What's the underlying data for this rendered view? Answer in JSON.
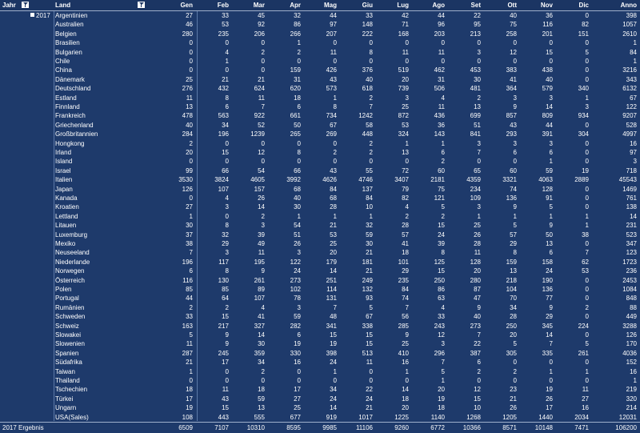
{
  "header": {
    "jahr": "Jahr",
    "land": "Land",
    "months": [
      "Gen",
      "Feb",
      "Mar",
      "Apr",
      "Mag",
      "Giu",
      "Lug",
      "Ago",
      "Set",
      "Ott",
      "Nov",
      "Dic"
    ],
    "anno": "Anno"
  },
  "year_label": "2017",
  "icons": {
    "filter": "filter-icon",
    "collapse": "collapse-icon"
  },
  "rows": [
    {
      "land": "Argentinien",
      "v": [
        "27",
        "33",
        "45",
        "32",
        "44",
        "33",
        "42",
        "44",
        "22",
        "40",
        "36",
        "0",
        "398"
      ]
    },
    {
      "land": "Australien",
      "v": [
        "46",
        "53",
        "92",
        "86",
        "97",
        "148",
        "71",
        "96",
        "95",
        "75",
        "116",
        "82",
        "1057"
      ]
    },
    {
      "land": "Belgien",
      "v": [
        "280",
        "235",
        "206",
        "266",
        "207",
        "222",
        "168",
        "203",
        "213",
        "258",
        "201",
        "151",
        "2610"
      ]
    },
    {
      "land": "Brasilien",
      "v": [
        "0",
        "0",
        "0",
        "1",
        "0",
        "0",
        "0",
        "0",
        "0",
        "0",
        "0",
        "0",
        "1"
      ]
    },
    {
      "land": "Bulgarien",
      "v": [
        "0",
        "4",
        "2",
        "2",
        "11",
        "8",
        "11",
        "11",
        "3",
        "12",
        "15",
        "5",
        "84"
      ]
    },
    {
      "land": "Chile",
      "v": [
        "0",
        "1",
        "0",
        "0",
        "0",
        "0",
        "0",
        "0",
        "0",
        "0",
        "0",
        "0",
        "1"
      ]
    },
    {
      "land": "China",
      "v": [
        "0",
        "0",
        "0",
        "159",
        "426",
        "376",
        "519",
        "462",
        "453",
        "383",
        "438",
        "0",
        "3216"
      ]
    },
    {
      "land": "Dänemark",
      "v": [
        "25",
        "21",
        "21",
        "31",
        "43",
        "40",
        "20",
        "31",
        "30",
        "41",
        "40",
        "0",
        "343"
      ]
    },
    {
      "land": "Deutschland",
      "v": [
        "276",
        "432",
        "624",
        "620",
        "573",
        "618",
        "739",
        "506",
        "481",
        "364",
        "579",
        "340",
        "6132"
      ]
    },
    {
      "land": "Estland",
      "v": [
        "11",
        "8",
        "11",
        "18",
        "1",
        "2",
        "3",
        "4",
        "2",
        "3",
        "3",
        "1",
        "67"
      ]
    },
    {
      "land": "Finnland",
      "v": [
        "13",
        "6",
        "7",
        "6",
        "8",
        "7",
        "25",
        "11",
        "13",
        "9",
        "14",
        "3",
        "122"
      ]
    },
    {
      "land": "Frankreich",
      "v": [
        "478",
        "563",
        "922",
        "661",
        "734",
        "1242",
        "872",
        "436",
        "699",
        "857",
        "809",
        "934",
        "9207"
      ]
    },
    {
      "land": "Griechenland",
      "v": [
        "40",
        "34",
        "52",
        "50",
        "67",
        "58",
        "53",
        "36",
        "51",
        "43",
        "44",
        "0",
        "528"
      ]
    },
    {
      "land": "Großbritannien",
      "v": [
        "284",
        "196",
        "1239",
        "265",
        "269",
        "448",
        "324",
        "143",
        "841",
        "293",
        "391",
        "304",
        "4997"
      ]
    },
    {
      "land": "Hongkong",
      "v": [
        "2",
        "0",
        "0",
        "0",
        "0",
        "2",
        "1",
        "1",
        "3",
        "3",
        "3",
        "0",
        "16"
      ]
    },
    {
      "land": "Irland",
      "v": [
        "20",
        "15",
        "12",
        "8",
        "2",
        "2",
        "13",
        "6",
        "7",
        "6",
        "6",
        "0",
        "97"
      ]
    },
    {
      "land": "Island",
      "v": [
        "0",
        "0",
        "0",
        "0",
        "0",
        "0",
        "0",
        "2",
        "0",
        "0",
        "1",
        "0",
        "3"
      ]
    },
    {
      "land": "Israel",
      "v": [
        "99",
        "66",
        "54",
        "66",
        "43",
        "55",
        "72",
        "60",
        "65",
        "60",
        "59",
        "19",
        "718"
      ]
    },
    {
      "land": "Italien",
      "v": [
        "3530",
        "3824",
        "4605",
        "3992",
        "4626",
        "4746",
        "3407",
        "2181",
        "4359",
        "3321",
        "4063",
        "2889",
        "45543"
      ]
    },
    {
      "land": "Japan",
      "v": [
        "126",
        "107",
        "157",
        "68",
        "84",
        "137",
        "79",
        "75",
        "234",
        "74",
        "128",
        "0",
        "1469"
      ]
    },
    {
      "land": "Kanada",
      "v": [
        "0",
        "4",
        "26",
        "40",
        "68",
        "84",
        "82",
        "121",
        "109",
        "136",
        "91",
        "0",
        "761"
      ]
    },
    {
      "land": "Kroatien",
      "v": [
        "27",
        "3",
        "14",
        "30",
        "28",
        "10",
        "4",
        "5",
        "3",
        "9",
        "5",
        "0",
        "138"
      ]
    },
    {
      "land": "Lettland",
      "v": [
        "1",
        "0",
        "2",
        "1",
        "1",
        "1",
        "2",
        "2",
        "1",
        "1",
        "1",
        "1",
        "14"
      ]
    },
    {
      "land": "Litauen",
      "v": [
        "30",
        "8",
        "3",
        "54",
        "21",
        "32",
        "28",
        "15",
        "25",
        "5",
        "9",
        "1",
        "231"
      ]
    },
    {
      "land": "Luxemburg",
      "v": [
        "37",
        "32",
        "39",
        "51",
        "53",
        "59",
        "57",
        "24",
        "26",
        "57",
        "50",
        "38",
        "523"
      ]
    },
    {
      "land": "Mexiko",
      "v": [
        "38",
        "29",
        "49",
        "26",
        "25",
        "30",
        "41",
        "39",
        "28",
        "29",
        "13",
        "0",
        "347"
      ]
    },
    {
      "land": "Neuseeland",
      "v": [
        "7",
        "3",
        "11",
        "3",
        "20",
        "21",
        "18",
        "8",
        "11",
        "8",
        "6",
        "7",
        "123"
      ]
    },
    {
      "land": "Niederlande",
      "v": [
        "196",
        "117",
        "195",
        "122",
        "179",
        "181",
        "101",
        "125",
        "128",
        "159",
        "158",
        "62",
        "1723"
      ]
    },
    {
      "land": "Norwegen",
      "v": [
        "6",
        "8",
        "9",
        "24",
        "14",
        "21",
        "29",
        "15",
        "20",
        "13",
        "24",
        "53",
        "236"
      ]
    },
    {
      "land": "Österreich",
      "v": [
        "116",
        "130",
        "261",
        "273",
        "251",
        "249",
        "235",
        "250",
        "280",
        "218",
        "190",
        "0",
        "2453"
      ]
    },
    {
      "land": "Polen",
      "v": [
        "85",
        "85",
        "89",
        "102",
        "114",
        "132",
        "84",
        "86",
        "87",
        "104",
        "136",
        "0",
        "1084"
      ]
    },
    {
      "land": "Portugal",
      "v": [
        "44",
        "64",
        "107",
        "78",
        "131",
        "93",
        "74",
        "63",
        "47",
        "70",
        "77",
        "0",
        "848"
      ]
    },
    {
      "land": "Rumänien",
      "v": [
        "2",
        "2",
        "4",
        "3",
        "7",
        "5",
        "7",
        "4",
        "9",
        "34",
        "9",
        "2",
        "88"
      ]
    },
    {
      "land": "Schweden",
      "v": [
        "33",
        "15",
        "41",
        "59",
        "48",
        "67",
        "56",
        "33",
        "40",
        "28",
        "29",
        "0",
        "449"
      ]
    },
    {
      "land": "Schweiz",
      "v": [
        "163",
        "217",
        "327",
        "282",
        "341",
        "338",
        "285",
        "243",
        "273",
        "250",
        "345",
        "224",
        "3288"
      ]
    },
    {
      "land": "Slowakei",
      "v": [
        "5",
        "9",
        "14",
        "6",
        "15",
        "15",
        "9",
        "12",
        "7",
        "20",
        "14",
        "0",
        "126"
      ]
    },
    {
      "land": "Slowenien",
      "v": [
        "11",
        "9",
        "30",
        "19",
        "19",
        "15",
        "25",
        "3",
        "22",
        "5",
        "7",
        "5",
        "170"
      ]
    },
    {
      "land": "Spanien",
      "v": [
        "287",
        "245",
        "359",
        "330",
        "398",
        "513",
        "410",
        "296",
        "387",
        "305",
        "335",
        "261",
        "4036"
      ]
    },
    {
      "land": "Südafrika",
      "v": [
        "21",
        "17",
        "34",
        "16",
        "24",
        "11",
        "16",
        "7",
        "6",
        "0",
        "0",
        "0",
        "152"
      ]
    },
    {
      "land": "Taiwan",
      "v": [
        "1",
        "0",
        "2",
        "0",
        "1",
        "0",
        "1",
        "5",
        "2",
        "2",
        "1",
        "1",
        "16"
      ]
    },
    {
      "land": "Thailand",
      "v": [
        "0",
        "0",
        "0",
        "0",
        "0",
        "0",
        "0",
        "1",
        "0",
        "0",
        "0",
        "0",
        "1"
      ]
    },
    {
      "land": "Tschechien",
      "v": [
        "18",
        "11",
        "18",
        "17",
        "34",
        "22",
        "14",
        "20",
        "12",
        "23",
        "19",
        "11",
        "219"
      ]
    },
    {
      "land": "Türkei",
      "v": [
        "17",
        "43",
        "59",
        "27",
        "24",
        "24",
        "18",
        "19",
        "15",
        "21",
        "26",
        "27",
        "320"
      ]
    },
    {
      "land": "Ungarn",
      "v": [
        "19",
        "15",
        "13",
        "25",
        "14",
        "21",
        "20",
        "18",
        "10",
        "26",
        "17",
        "16",
        "214"
      ]
    },
    {
      "land": "USA(Sales)",
      "v": [
        "108",
        "443",
        "555",
        "677",
        "919",
        "1017",
        "1225",
        "1140",
        "1268",
        "1205",
        "1440",
        "2034",
        "12031"
      ]
    }
  ],
  "total": {
    "label": "2017 Ergebnis",
    "v": [
      "6509",
      "7107",
      "10310",
      "8595",
      "9985",
      "11106",
      "9260",
      "6772",
      "10366",
      "8571",
      "10148",
      "7471",
      "106200"
    ]
  }
}
